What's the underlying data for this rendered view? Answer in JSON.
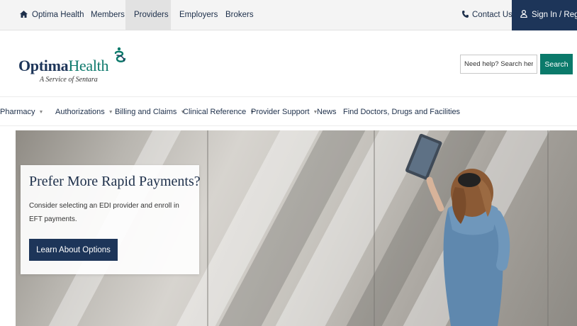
{
  "topbar": {
    "tabs": [
      {
        "label": "Optima Health",
        "icon": "home-icon"
      },
      {
        "label": "Members"
      },
      {
        "label": "Providers",
        "active": true
      },
      {
        "label": "Employers"
      },
      {
        "label": "Brokers"
      }
    ],
    "contact": {
      "label": "Contact Us",
      "icon": "phone-icon"
    },
    "signin": {
      "label": "Sign In / Register",
      "icon": "user-icon"
    }
  },
  "header": {
    "logo": {
      "word_bold": "Optima",
      "word_light": "Health",
      "tagline": "A Service of Sentara"
    },
    "search": {
      "placeholder": "Need help? Search here.",
      "button_label": "Search"
    }
  },
  "nav": {
    "items": [
      {
        "label": "Pharmacy",
        "dropdown": true
      },
      {
        "label": "Authorizations",
        "dropdown": true
      },
      {
        "label": "Billing and Claims",
        "dropdown": true
      },
      {
        "label": "Clinical Reference",
        "dropdown": true
      },
      {
        "label": "Provider Support",
        "dropdown": true
      },
      {
        "label": "News",
        "dropdown": false
      },
      {
        "label": "Find Doctors, Drugs and Facilities",
        "dropdown": false
      }
    ]
  },
  "hero": {
    "title": "Prefer More Rapid Payments?",
    "text": "Consider selecting an EDI provider and enroll in EFT payments.",
    "button_label": "Learn About Options"
  },
  "colors": {
    "navy": "#1d3559",
    "teal": "#0b7a6b",
    "topbar_bg": "#f4f4f4"
  }
}
